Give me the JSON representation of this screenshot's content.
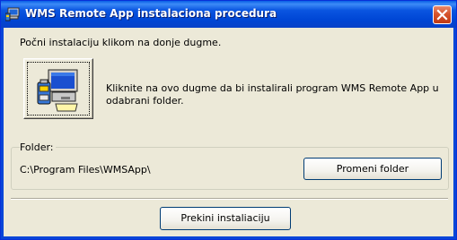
{
  "window": {
    "title": "WMS Remote App instalaciona procedura",
    "close_icon": "close-icon"
  },
  "intro_text": "Počni instalaciju klikom na donje dugme.",
  "install": {
    "icon": "computer-install-icon",
    "description": "Kliknite na ovo dugme da bi instalirali program WMS Remote App u odabrani folder."
  },
  "folder": {
    "label": "Folder:",
    "path": "C:\\Program Files\\WMSApp\\",
    "change_button": "Promeni folder"
  },
  "cancel_button": "Prekini instaliaciju",
  "colors": {
    "titlebar": "#0a55e0",
    "face": "#ece9d8",
    "close": "#d6542c"
  }
}
